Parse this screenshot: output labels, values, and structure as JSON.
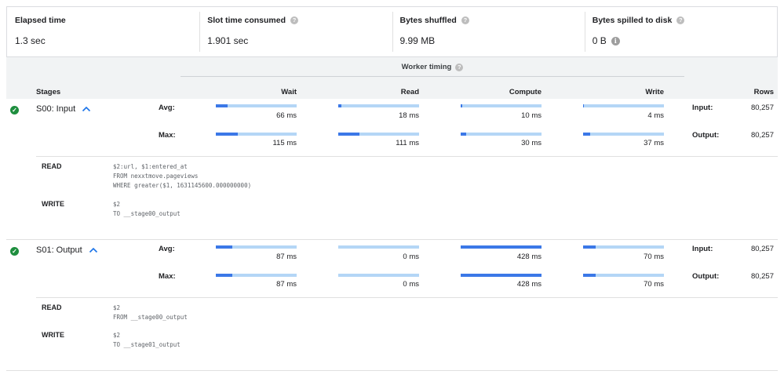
{
  "summary": [
    {
      "label": "Elapsed time",
      "value": "1.3 sec",
      "help": false,
      "info": false
    },
    {
      "label": "Slot time consumed",
      "value": "1.901 sec",
      "help": true,
      "info": false
    },
    {
      "label": "Bytes shuffled",
      "value": "9.99 MB",
      "help": true,
      "info": false
    },
    {
      "label": "Bytes spilled to disk",
      "value": "0 B",
      "help": true,
      "info": true
    }
  ],
  "worker_timing": {
    "title": "Worker timing"
  },
  "columns": {
    "stages": "Stages",
    "wait": "Wait",
    "read": "Read",
    "compute": "Compute",
    "write": "Write",
    "rows": "Rows"
  },
  "labels": {
    "avg": "Avg:",
    "max": "Max:",
    "input": "Input:",
    "output": "Output:",
    "read": "READ",
    "write": "WRITE"
  },
  "stages": [
    {
      "name": "S00: Input",
      "avg": [
        {
          "value": "66 ms",
          "fraction": 0.15
        },
        {
          "value": "18 ms",
          "fraction": 0.04
        },
        {
          "value": "10 ms",
          "fraction": 0.02
        },
        {
          "value": "4 ms",
          "fraction": 0.01
        }
      ],
      "max": [
        {
          "value": "115 ms",
          "fraction": 0.27
        },
        {
          "value": "111 ms",
          "fraction": 0.26
        },
        {
          "value": "30 ms",
          "fraction": 0.07
        },
        {
          "value": "37 ms",
          "fraction": 0.09
        }
      ],
      "input_rows": "80,257",
      "output_rows": "80,257",
      "read_code": "$2:url, $1:entered_at\nFROM nexxtmove.pageviews\nWHERE greater($1, 1631145600.000000000)",
      "write_code": "$2\nTO __stage00_output"
    },
    {
      "name": "S01: Output",
      "avg": [
        {
          "value": "87 ms",
          "fraction": 0.2
        },
        {
          "value": "0 ms",
          "fraction": 0
        },
        {
          "value": "428 ms",
          "fraction": 1.0
        },
        {
          "value": "70 ms",
          "fraction": 0.16
        }
      ],
      "max": [
        {
          "value": "87 ms",
          "fraction": 0.2
        },
        {
          "value": "0 ms",
          "fraction": 0
        },
        {
          "value": "428 ms",
          "fraction": 1.0
        },
        {
          "value": "70 ms",
          "fraction": 0.16
        }
      ],
      "input_rows": "80,257",
      "output_rows": "80,257",
      "read_code": "$2\nFROM __stage00_output",
      "write_code": "$2\nTO __stage01_output"
    }
  ],
  "colors": {
    "bar_track": "#b4d6f6",
    "bar_fill": "#3b78e7",
    "success": "#1e8e3e"
  }
}
